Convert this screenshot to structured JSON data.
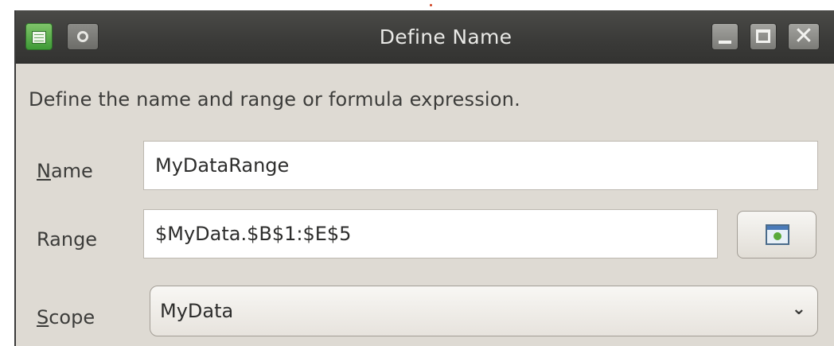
{
  "window": {
    "title": "Define Name",
    "icons": {
      "app": "calc-spreadsheet-icon",
      "menu": "window-menu-icon",
      "minimize": "minimize-icon",
      "maximize": "maximize-icon",
      "close": "close-icon"
    },
    "close_glyph": "✕"
  },
  "dialog": {
    "description": "Define the name and range or formula expression.",
    "name": {
      "label_mnemonic": "N",
      "label_rest": "ame",
      "value": "MyDataRange"
    },
    "range": {
      "label": "Range",
      "value": "$MyData.$B$1:$E$5",
      "shrink_button_icon": "shrink-range-icon"
    },
    "scope": {
      "label_mnemonic": "S",
      "label_rest": "cope",
      "selected": "MyData",
      "chevron": "⌄"
    }
  },
  "colors": {
    "titlebar": "#3a3a38",
    "dialog_bg": "#dedad3",
    "title_text": "#e9e9e6"
  }
}
